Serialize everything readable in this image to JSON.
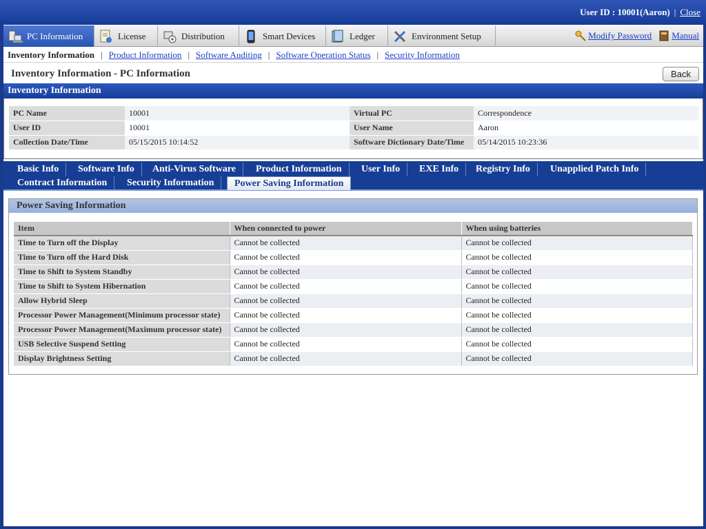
{
  "topbar": {
    "user_label": "User ID : 10001(Aaron)",
    "separator": "|",
    "close": "Close"
  },
  "main_nav": {
    "tabs": [
      {
        "label": "PC Information",
        "icon": "pc-icon",
        "active": true
      },
      {
        "label": "License",
        "icon": "license-icon"
      },
      {
        "label": "Distribution",
        "icon": "distribution-icon"
      },
      {
        "label": "Smart Devices",
        "icon": "smart-device-icon"
      },
      {
        "label": "Ledger",
        "icon": "ledger-icon"
      },
      {
        "label": "Environment Setup",
        "icon": "tools-icon"
      }
    ],
    "modify_password": "Modify Password",
    "manual": "Manual"
  },
  "sub_nav": {
    "items": [
      "Inventory Information",
      "Product Information",
      "Software Auditing",
      "Software Operation Status",
      "Security Information"
    ],
    "separator": "|"
  },
  "page_title": "Inventory Information - PC Information",
  "back_button": "Back",
  "inventory": {
    "heading": "Inventory Information",
    "rows": [
      {
        "l1": "PC Name",
        "v1": "10001",
        "l2": "Virtual PC",
        "v2": "Correspondence"
      },
      {
        "l1": "User ID",
        "v1": "10001",
        "l2": "User Name",
        "v2": "Aaron"
      },
      {
        "l1": "Collection Date/Time",
        "v1": "05/15/2015 10:14:52",
        "l2": "Software Dictionary Date/Time",
        "v2": "05/14/2015 10:23:36"
      }
    ]
  },
  "detail_tabs": {
    "row1": [
      "Basic Info",
      "Software Info",
      "Anti-Virus Software",
      "Product Information",
      "User Info",
      "EXE Info",
      "Registry Info",
      "Unapplied Patch Info"
    ],
    "row2": [
      "Contract Information",
      "Security Information",
      "Power Saving Information"
    ],
    "active": "Power Saving Information"
  },
  "power_saving": {
    "title": "Power Saving Information",
    "columns": [
      "Item",
      "When connected to power",
      "When using batteries"
    ],
    "rows": [
      [
        "Time to Turn off the Display",
        "Cannot be collected",
        "Cannot be collected"
      ],
      [
        "Time to Turn off the Hard Disk",
        "Cannot be collected",
        "Cannot be collected"
      ],
      [
        "Time to Shift to System Standby",
        "Cannot be collected",
        "Cannot be collected"
      ],
      [
        "Time to Shift to System Hibernation",
        "Cannot be collected",
        "Cannot be collected"
      ],
      [
        "Allow Hybrid Sleep",
        "Cannot be collected",
        "Cannot be collected"
      ],
      [
        "Processor Power Management(Minimum processor state)",
        "Cannot be collected",
        "Cannot be collected"
      ],
      [
        "Processor Power Management(Maximum processor state)",
        "Cannot be collected",
        "Cannot be collected"
      ],
      [
        "USB Selective Suspend Setting",
        "Cannot be collected",
        "Cannot be collected"
      ],
      [
        "Display Brightness Setting",
        "Cannot be collected",
        "Cannot be collected"
      ]
    ]
  }
}
